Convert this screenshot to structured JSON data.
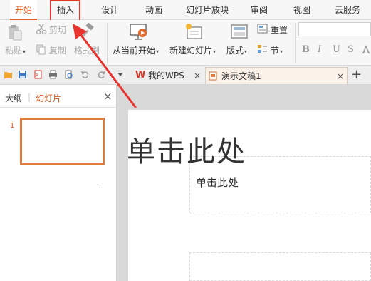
{
  "tabs": [
    {
      "label": "开始",
      "active": true
    },
    {
      "label": "插入"
    },
    {
      "label": "设计"
    },
    {
      "label": "动画"
    },
    {
      "label": "幻灯片放映"
    },
    {
      "label": "审阅"
    },
    {
      "label": "视图"
    },
    {
      "label": "云服务"
    }
  ],
  "ribbon": {
    "paste": "粘贴",
    "cut": "剪切",
    "copy": "复制",
    "format_painter": "格式刷",
    "start_from_current": "从当前开始",
    "new_slide": "新建幻灯片",
    "layout": "版式",
    "reset": "重置",
    "section": "节",
    "bold": "B",
    "italic": "I",
    "underline": "U",
    "strike": "S"
  },
  "doc_tabs": {
    "wps": "我的WPS",
    "presentation": "演示文稿1",
    "close": "×",
    "new_tab": "+"
  },
  "side_panel": {
    "outline": "大纲",
    "slides": "幻灯片",
    "close": "×",
    "thumb_number": "1"
  },
  "slide": {
    "title_placeholder": "单击此处",
    "subtitle_placeholder": "单击此处"
  },
  "colors": {
    "accent": "#e15a1f",
    "annotation": "#e8342f"
  }
}
